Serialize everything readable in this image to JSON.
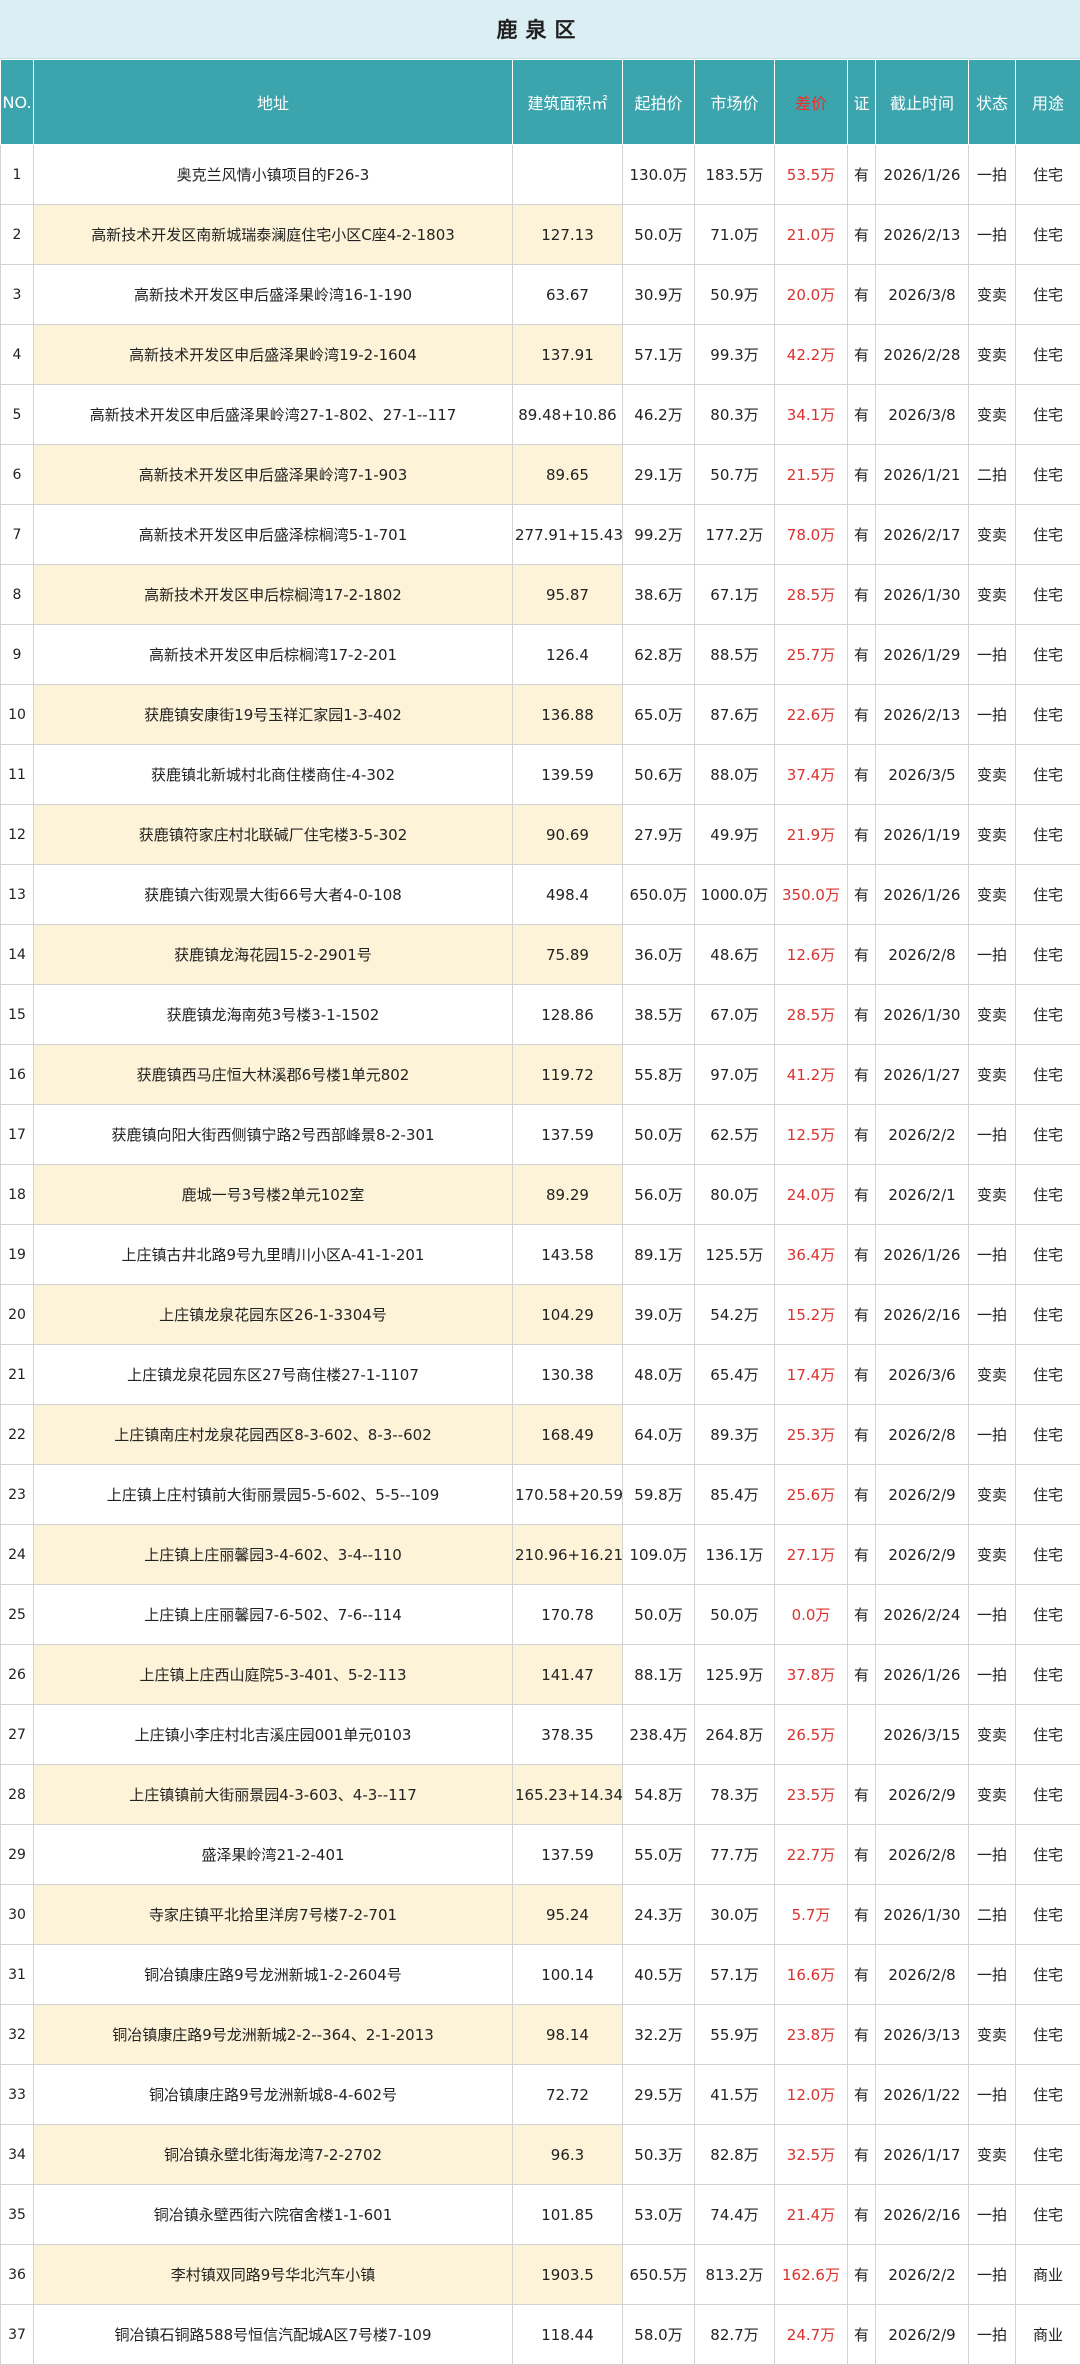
{
  "title": "鹿泉区",
  "headers": {
    "no": "NO.",
    "address": "地址",
    "area": "建筑面积㎡",
    "start_price": "起拍价",
    "market_price": "市场价",
    "diff": "差价",
    "cert": "证",
    "deadline": "截止时间",
    "status": "状态",
    "usage": "用途"
  },
  "colors": {
    "header_bg": "#3ba4ad",
    "title_bg": "#dbeef3",
    "row_highlight": "#fdf3d8",
    "diff_text": "#d9312c"
  },
  "rows": [
    {
      "no": "1",
      "address": "奥克兰风情小镇项目的F26-3",
      "area": "",
      "start": "130.0万",
      "market": "183.5万",
      "diff": "53.5万",
      "cert": "有",
      "deadline": "2026/1/26",
      "status": "一拍",
      "usage": "住宅"
    },
    {
      "no": "2",
      "address": "高新技术开发区南新城瑞泰澜庭住宅小区C座4-2-1803",
      "area": "127.13",
      "start": "50.0万",
      "market": "71.0万",
      "diff": "21.0万",
      "cert": "有",
      "deadline": "2026/2/13",
      "status": "一拍",
      "usage": "住宅"
    },
    {
      "no": "3",
      "address": "高新技术开发区申后盛泽果岭湾16-1-190",
      "area": "63.67",
      "start": "30.9万",
      "market": "50.9万",
      "diff": "20.0万",
      "cert": "有",
      "deadline": "2026/3/8",
      "status": "变卖",
      "usage": "住宅"
    },
    {
      "no": "4",
      "address": "高新技术开发区申后盛泽果岭湾19-2-1604",
      "area": "137.91",
      "start": "57.1万",
      "market": "99.3万",
      "diff": "42.2万",
      "cert": "有",
      "deadline": "2026/2/28",
      "status": "变卖",
      "usage": "住宅"
    },
    {
      "no": "5",
      "address": "高新技术开发区申后盛泽果岭湾27-1-802、27-1--117",
      "area": "89.48+10.86",
      "start": "46.2万",
      "market": "80.3万",
      "diff": "34.1万",
      "cert": "有",
      "deadline": "2026/3/8",
      "status": "变卖",
      "usage": "住宅"
    },
    {
      "no": "6",
      "address": "高新技术开发区申后盛泽果岭湾7-1-903",
      "area": "89.65",
      "start": "29.1万",
      "market": "50.7万",
      "diff": "21.5万",
      "cert": "有",
      "deadline": "2026/1/21",
      "status": "二拍",
      "usage": "住宅"
    },
    {
      "no": "7",
      "address": "高新技术开发区申后盛泽棕榈湾5-1-701",
      "area": "277.91+15.43",
      "start": "99.2万",
      "market": "177.2万",
      "diff": "78.0万",
      "cert": "有",
      "deadline": "2026/2/17",
      "status": "变卖",
      "usage": "住宅"
    },
    {
      "no": "8",
      "address": "高新技术开发区申后棕榈湾17-2-1802",
      "area": "95.87",
      "start": "38.6万",
      "market": "67.1万",
      "diff": "28.5万",
      "cert": "有",
      "deadline": "2026/1/30",
      "status": "变卖",
      "usage": "住宅"
    },
    {
      "no": "9",
      "address": "高新技术开发区申后棕榈湾17-2-201",
      "area": "126.4",
      "start": "62.8万",
      "market": "88.5万",
      "diff": "25.7万",
      "cert": "有",
      "deadline": "2026/1/29",
      "status": "一拍",
      "usage": "住宅"
    },
    {
      "no": "10",
      "address": "获鹿镇安康街19号玉祥汇家园1-3-402",
      "area": "136.88",
      "start": "65.0万",
      "market": "87.6万",
      "diff": "22.6万",
      "cert": "有",
      "deadline": "2026/2/13",
      "status": "一拍",
      "usage": "住宅"
    },
    {
      "no": "11",
      "address": "获鹿镇北新城村北商住楼商住-4-302",
      "area": "139.59",
      "start": "50.6万",
      "market": "88.0万",
      "diff": "37.4万",
      "cert": "有",
      "deadline": "2026/3/5",
      "status": "变卖",
      "usage": "住宅"
    },
    {
      "no": "12",
      "address": "获鹿镇符家庄村北联碱厂住宅楼3-5-302",
      "area": "90.69",
      "start": "27.9万",
      "market": "49.9万",
      "diff": "21.9万",
      "cert": "有",
      "deadline": "2026/1/19",
      "status": "变卖",
      "usage": "住宅"
    },
    {
      "no": "13",
      "address": "获鹿镇六街观景大街66号大者4-0-108",
      "area": "498.4",
      "start": "650.0万",
      "market": "1000.0万",
      "diff": "350.0万",
      "cert": "有",
      "deadline": "2026/1/26",
      "status": "变卖",
      "usage": "住宅"
    },
    {
      "no": "14",
      "address": "获鹿镇龙海花园15-2-2901号",
      "area": "75.89",
      "start": "36.0万",
      "market": "48.6万",
      "diff": "12.6万",
      "cert": "有",
      "deadline": "2026/2/8",
      "status": "一拍",
      "usage": "住宅"
    },
    {
      "no": "15",
      "address": "获鹿镇龙海南苑3号楼3-1-1502",
      "area": "128.86",
      "start": "38.5万",
      "market": "67.0万",
      "diff": "28.5万",
      "cert": "有",
      "deadline": "2026/1/30",
      "status": "变卖",
      "usage": "住宅"
    },
    {
      "no": "16",
      "address": "获鹿镇西马庄恒大林溪郡6号楼1单元802",
      "area": "119.72",
      "start": "55.8万",
      "market": "97.0万",
      "diff": "41.2万",
      "cert": "有",
      "deadline": "2026/1/27",
      "status": "变卖",
      "usage": "住宅"
    },
    {
      "no": "17",
      "address": "获鹿镇向阳大街西侧镇宁路2号西部峰景8-2-301",
      "area": "137.59",
      "start": "50.0万",
      "market": "62.5万",
      "diff": "12.5万",
      "cert": "有",
      "deadline": "2026/2/2",
      "status": "一拍",
      "usage": "住宅"
    },
    {
      "no": "18",
      "address": "鹿城一号3号楼2单元102室",
      "area": "89.29",
      "start": "56.0万",
      "market": "80.0万",
      "diff": "24.0万",
      "cert": "有",
      "deadline": "2026/2/1",
      "status": "变卖",
      "usage": "住宅"
    },
    {
      "no": "19",
      "address": "上庄镇古井北路9号九里晴川小区A-41-1-201",
      "area": "143.58",
      "start": "89.1万",
      "market": "125.5万",
      "diff": "36.4万",
      "cert": "有",
      "deadline": "2026/1/26",
      "status": "一拍",
      "usage": "住宅"
    },
    {
      "no": "20",
      "address": "上庄镇龙泉花园东区26-1-3304号",
      "area": "104.29",
      "start": "39.0万",
      "market": "54.2万",
      "diff": "15.2万",
      "cert": "有",
      "deadline": "2026/2/16",
      "status": "一拍",
      "usage": "住宅"
    },
    {
      "no": "21",
      "address": "上庄镇龙泉花园东区27号商住楼27-1-1107",
      "area": "130.38",
      "start": "48.0万",
      "market": "65.4万",
      "diff": "17.4万",
      "cert": "有",
      "deadline": "2026/3/6",
      "status": "变卖",
      "usage": "住宅"
    },
    {
      "no": "22",
      "address": "上庄镇南庄村龙泉花园西区8-3-602、8-3--602",
      "area": "168.49",
      "start": "64.0万",
      "market": "89.3万",
      "diff": "25.3万",
      "cert": "有",
      "deadline": "2026/2/8",
      "status": "一拍",
      "usage": "住宅"
    },
    {
      "no": "23",
      "address": "上庄镇上庄村镇前大街丽景园5-5-602、5-5--109",
      "area": "170.58+20.59",
      "start": "59.8万",
      "market": "85.4万",
      "diff": "25.6万",
      "cert": "有",
      "deadline": "2026/2/9",
      "status": "变卖",
      "usage": "住宅"
    },
    {
      "no": "24",
      "address": "上庄镇上庄丽馨园3-4-602、3-4--110",
      "area": "210.96+16.21",
      "start": "109.0万",
      "market": "136.1万",
      "diff": "27.1万",
      "cert": "有",
      "deadline": "2026/2/9",
      "status": "变卖",
      "usage": "住宅"
    },
    {
      "no": "25",
      "address": "上庄镇上庄丽馨园7-6-502、7-6--114",
      "area": "170.78",
      "start": "50.0万",
      "market": "50.0万",
      "diff": "0.0万",
      "cert": "有",
      "deadline": "2026/2/24",
      "status": "一拍",
      "usage": "住宅"
    },
    {
      "no": "26",
      "address": "上庄镇上庄西山庭院5-3-401、5-2-113",
      "area": "141.47",
      "start": "88.1万",
      "market": "125.9万",
      "diff": "37.8万",
      "cert": "有",
      "deadline": "2026/1/26",
      "status": "一拍",
      "usage": "住宅"
    },
    {
      "no": "27",
      "address": "上庄镇小李庄村北吉溪庄园001单元0103",
      "area": "378.35",
      "start": "238.4万",
      "market": "264.8万",
      "diff": "26.5万",
      "cert": "",
      "deadline": "2026/3/15",
      "status": "变卖",
      "usage": "住宅"
    },
    {
      "no": "28",
      "address": "上庄镇镇前大街丽景园4-3-603、4-3--117",
      "area": "165.23+14.34",
      "start": "54.8万",
      "market": "78.3万",
      "diff": "23.5万",
      "cert": "有",
      "deadline": "2026/2/9",
      "status": "变卖",
      "usage": "住宅"
    },
    {
      "no": "29",
      "address": "盛泽果岭湾21-2-401",
      "area": "137.59",
      "start": "55.0万",
      "market": "77.7万",
      "diff": "22.7万",
      "cert": "有",
      "deadline": "2026/2/8",
      "status": "一拍",
      "usage": "住宅"
    },
    {
      "no": "30",
      "address": "寺家庄镇平北拾里洋房7号楼7-2-701",
      "area": "95.24",
      "start": "24.3万",
      "market": "30.0万",
      "diff": "5.7万",
      "cert": "有",
      "deadline": "2026/1/30",
      "status": "二拍",
      "usage": "住宅"
    },
    {
      "no": "31",
      "address": "铜冶镇康庄路9号龙洲新城1-2-2604号",
      "area": "100.14",
      "start": "40.5万",
      "market": "57.1万",
      "diff": "16.6万",
      "cert": "有",
      "deadline": "2026/2/8",
      "status": "一拍",
      "usage": "住宅"
    },
    {
      "no": "32",
      "address": "铜冶镇康庄路9号龙洲新城2-2--364、2-1-2013",
      "area": "98.14",
      "start": "32.2万",
      "market": "55.9万",
      "diff": "23.8万",
      "cert": "有",
      "deadline": "2026/3/13",
      "status": "变卖",
      "usage": "住宅"
    },
    {
      "no": "33",
      "address": "铜冶镇康庄路9号龙洲新城8-4-602号",
      "area": "72.72",
      "start": "29.5万",
      "market": "41.5万",
      "diff": "12.0万",
      "cert": "有",
      "deadline": "2026/1/22",
      "status": "一拍",
      "usage": "住宅"
    },
    {
      "no": "34",
      "address": "铜冶镇永壁北街海龙湾7-2-2702",
      "area": "96.3",
      "start": "50.3万",
      "market": "82.8万",
      "diff": "32.5万",
      "cert": "有",
      "deadline": "2026/1/17",
      "status": "变卖",
      "usage": "住宅"
    },
    {
      "no": "35",
      "address": "铜冶镇永壁西街六院宿舍楼1-1-601",
      "area": "101.85",
      "start": "53.0万",
      "market": "74.4万",
      "diff": "21.4万",
      "cert": "有",
      "deadline": "2026/2/16",
      "status": "一拍",
      "usage": "住宅"
    },
    {
      "no": "36",
      "address": "李村镇双同路9号华北汽车小镇",
      "area": "1903.5",
      "start": "650.5万",
      "market": "813.2万",
      "diff": "162.6万",
      "cert": "有",
      "deadline": "2026/2/2",
      "status": "一拍",
      "usage": "商业"
    },
    {
      "no": "37",
      "address": "铜冶镇石铜路588号恒信汽配城A区7号楼7-109",
      "area": "118.44",
      "start": "58.0万",
      "market": "82.7万",
      "diff": "24.7万",
      "cert": "有",
      "deadline": "2026/2/9",
      "status": "一拍",
      "usage": "商业"
    }
  ]
}
